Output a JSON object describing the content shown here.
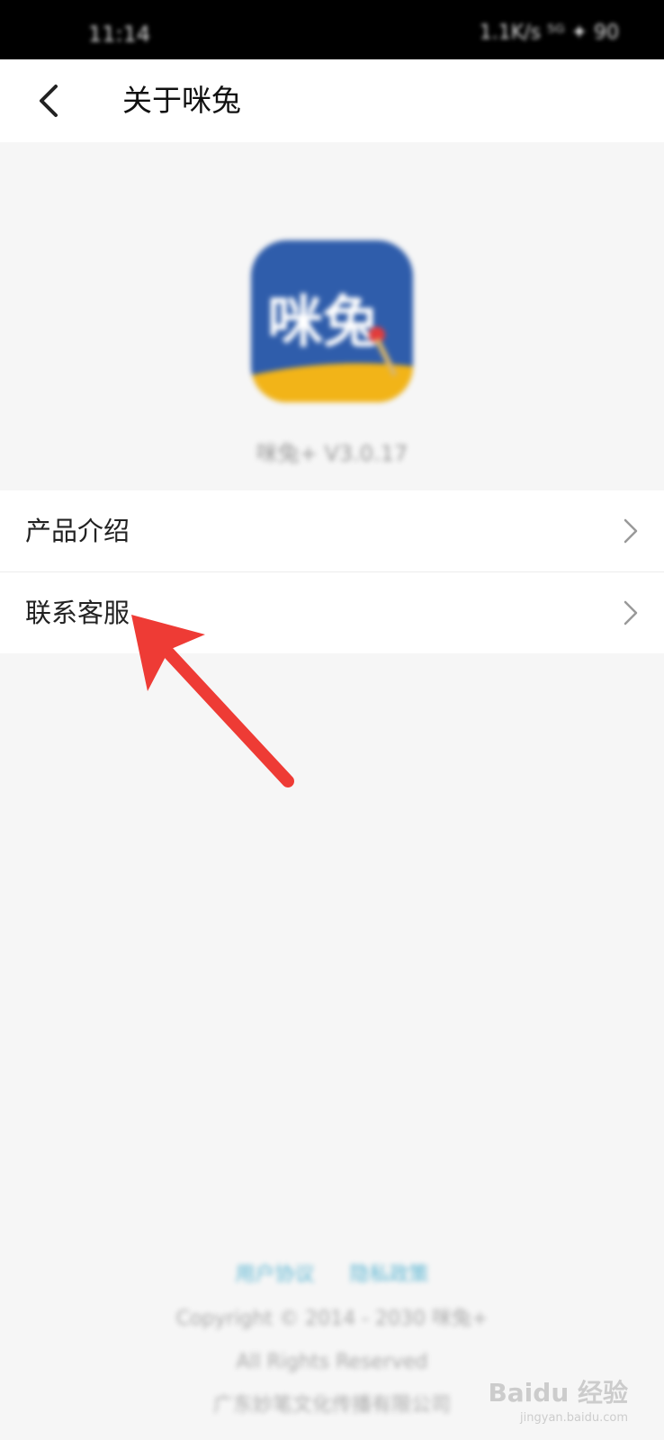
{
  "status_bar": {
    "time": "11:14",
    "icons_text": "1.1K/s ⁵ᴳ ✦ 90"
  },
  "nav": {
    "title": "关于咪兔"
  },
  "app": {
    "icon_text": "咪兔",
    "version": "咪兔+ V3.0.17"
  },
  "menu": {
    "items": [
      {
        "label": "产品介绍"
      },
      {
        "label": "联系客服"
      }
    ]
  },
  "footer": {
    "links": [
      "用户协议",
      "隐私政策"
    ],
    "copyright": "Copyright © 2014 - 2030 咪兔+",
    "rights": "All Rights Reserved",
    "company": "广东妙笔文化传播有限公司"
  },
  "watermark": {
    "brand": "Baidu 经验",
    "url": "jingyan.baidu.com"
  },
  "colors": {
    "arrow": "#ee3b35",
    "icon_blue": "#2f5dab",
    "icon_yellow": "#f2b418"
  }
}
